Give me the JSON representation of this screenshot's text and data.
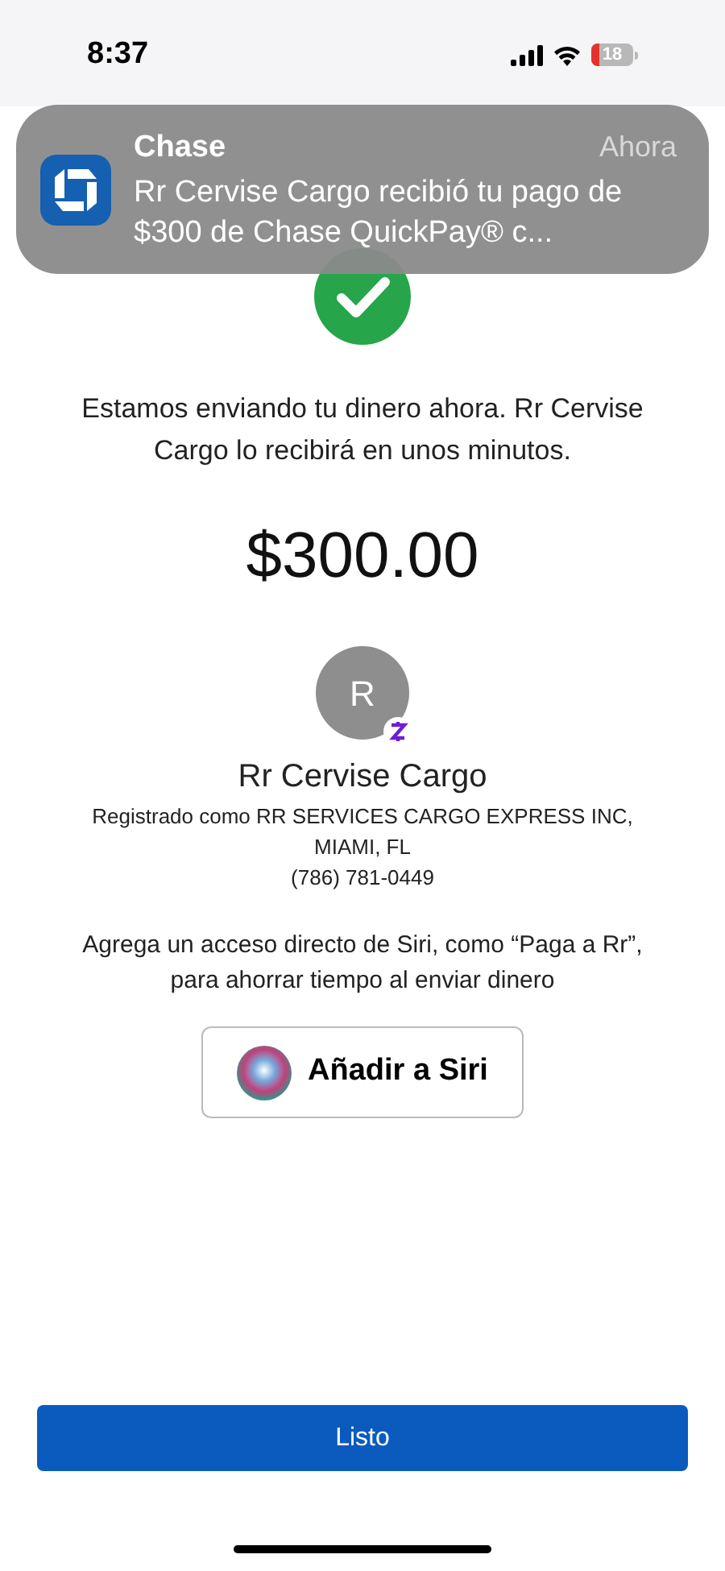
{
  "status_bar": {
    "time": "8:37",
    "battery": "18"
  },
  "notification": {
    "app": "Chase",
    "time": "Ahora",
    "message": "Rr Cervise Cargo  recibió tu pago de $300 de Chase QuickPay® c..."
  },
  "message": "Estamos enviando tu dinero ahora. Rr Cervise Cargo  lo recibirá en unos minutos.",
  "amount": "$300.00",
  "recipient": {
    "initial": "R",
    "name": "Rr Cervise Cargo",
    "registered": "Registrado como RR SERVICES CARGO EXPRESS INC,",
    "location": "MIAMI, FL",
    "phone": "(786) 781-0449"
  },
  "siri_hint": "Agrega un acceso directo de Siri, como “Paga a Rr”, para ahorrar tiempo al enviar dinero",
  "siri_button": "Añadir a Siri",
  "done_button": "Listo"
}
